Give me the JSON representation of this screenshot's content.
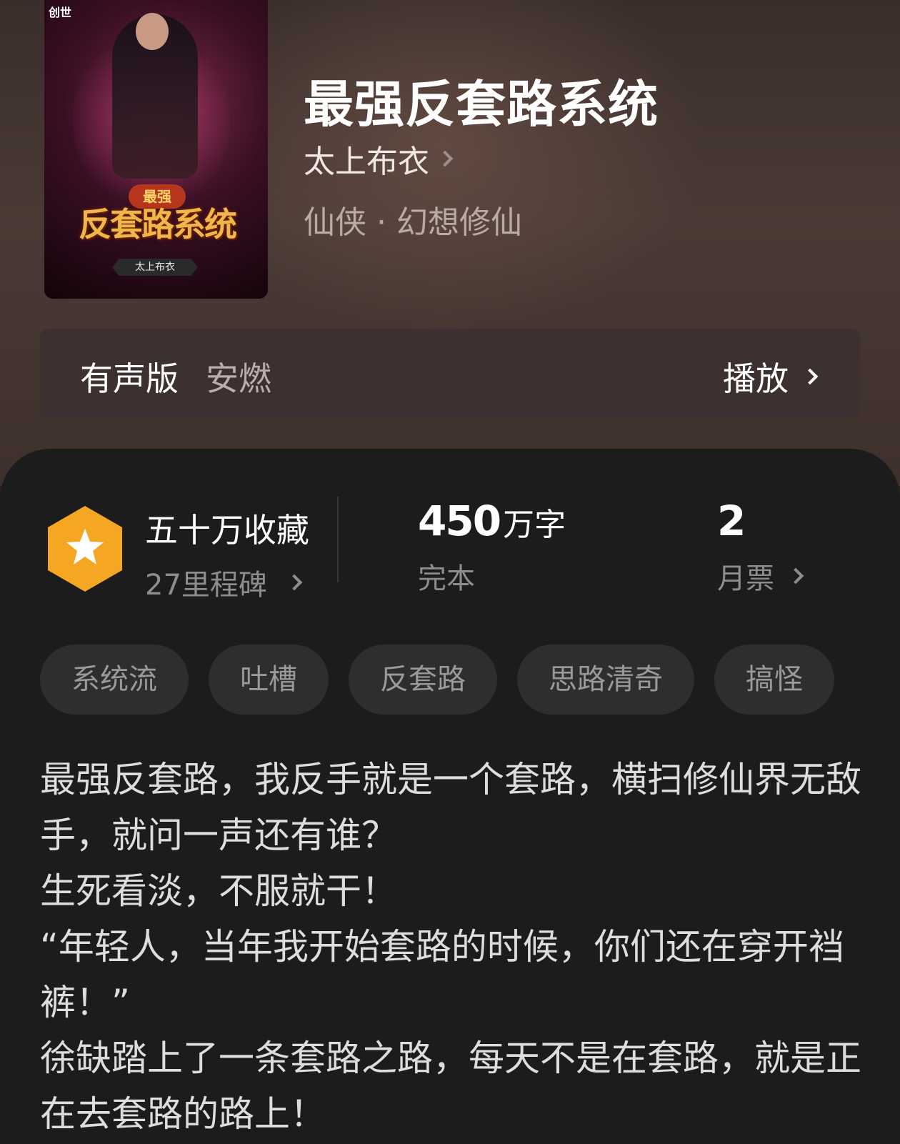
{
  "book": {
    "title": "最强反套路系统",
    "author": "太上布衣",
    "genre": "仙侠 · 幻想修仙",
    "cover": {
      "publisher_logo": "创世",
      "badge_text": "最强",
      "title_art": "反套路系统",
      "author_strip": "太上布衣"
    }
  },
  "audio": {
    "label": "有声版",
    "narrator": "安燃",
    "play_label": "播放"
  },
  "stats": {
    "collections": "五十万收藏",
    "milestones": "27里程碑",
    "words_number": "450",
    "words_unit": "万字",
    "status": "完本",
    "monthly_votes": "2",
    "monthly_votes_label": "月票"
  },
  "tags": [
    "系统流",
    "吐槽",
    "反套路",
    "思路清奇",
    "搞怪"
  ],
  "description": [
    "最强反套路，我反手就是一个套路，横扫修仙界无敌手，就问一声还有谁？",
    "生死看淡，不服就干！",
    "“年轻人，当年我开始套路的时候，你们还在穿开裆裤！”",
    "徐缺踏上了一条套路之路，每天不是在套路，就是正在去套路的路上！"
  ],
  "colors": {
    "badge_gold": "#f5a623",
    "panel_bg": "#1c1c1c",
    "tag_bg": "#2e2e2e"
  }
}
